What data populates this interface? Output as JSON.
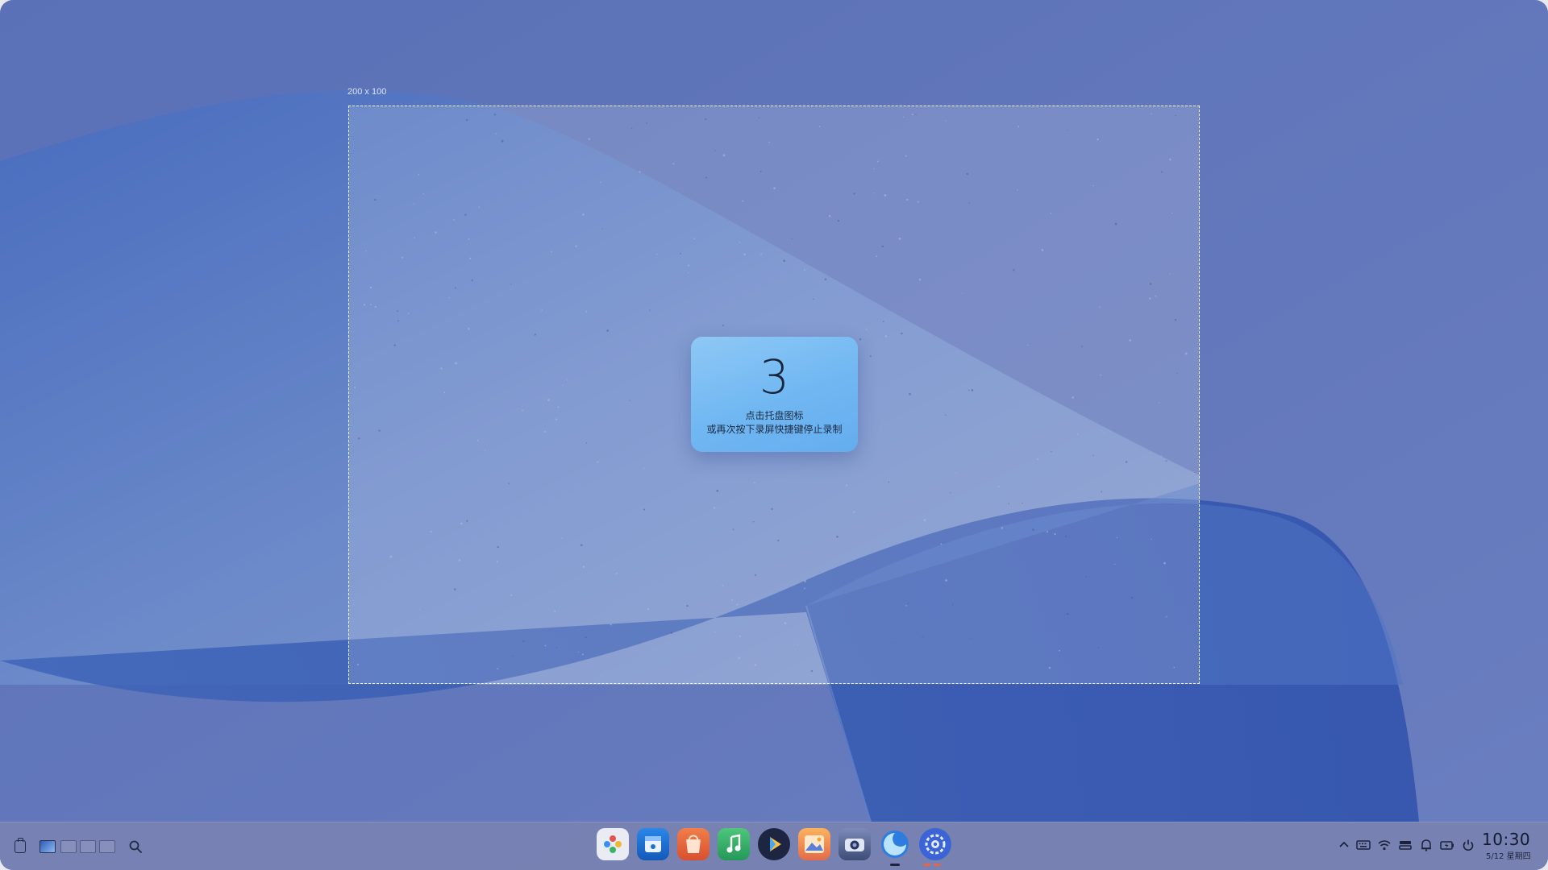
{
  "recording": {
    "selection_size_label": "200 x 100",
    "countdown": "3",
    "hint_line1": "点击托盘图标",
    "hint_line2": "或再次按下录屏快捷键停止录制"
  },
  "taskbar": {
    "left": {
      "clipboard_icon": "clipboard-icon",
      "workspaces": [
        {
          "name": "workspace-1",
          "active": true
        },
        {
          "name": "workspace-2",
          "active": false
        },
        {
          "name": "workspace-3",
          "active": false
        },
        {
          "name": "workspace-4",
          "active": false
        }
      ],
      "search_icon": "search-icon"
    },
    "dock_apps": [
      {
        "name": "launcher-icon",
        "color": "#e9ecf3"
      },
      {
        "name": "file-manager-icon",
        "color": "#1d6fd1"
      },
      {
        "name": "app-store-icon",
        "color": "#e4683e"
      },
      {
        "name": "music-icon",
        "color": "#36b267"
      },
      {
        "name": "video-player-icon",
        "color": "#1d2540"
      },
      {
        "name": "image-viewer-icon",
        "color": "#f08a5b"
      },
      {
        "name": "camera-icon",
        "color": "#4c5c86"
      },
      {
        "name": "browser-icon",
        "color": "#2d7de0"
      },
      {
        "name": "settings-icon",
        "color": "#3b64d6"
      }
    ],
    "tray": {
      "icons": [
        "chevron-up-icon",
        "keyboard-icon",
        "wifi-icon",
        "storage-icon",
        "bell-icon",
        "battery-icon",
        "power-icon"
      ]
    },
    "clock": {
      "time": "10:30",
      "date": "5/12 星期四"
    }
  },
  "colors": {
    "accent": "#3b82e6",
    "taskbar": "#7882b2",
    "card_top": "#8ec8f5",
    "card_bottom": "#64adee"
  }
}
